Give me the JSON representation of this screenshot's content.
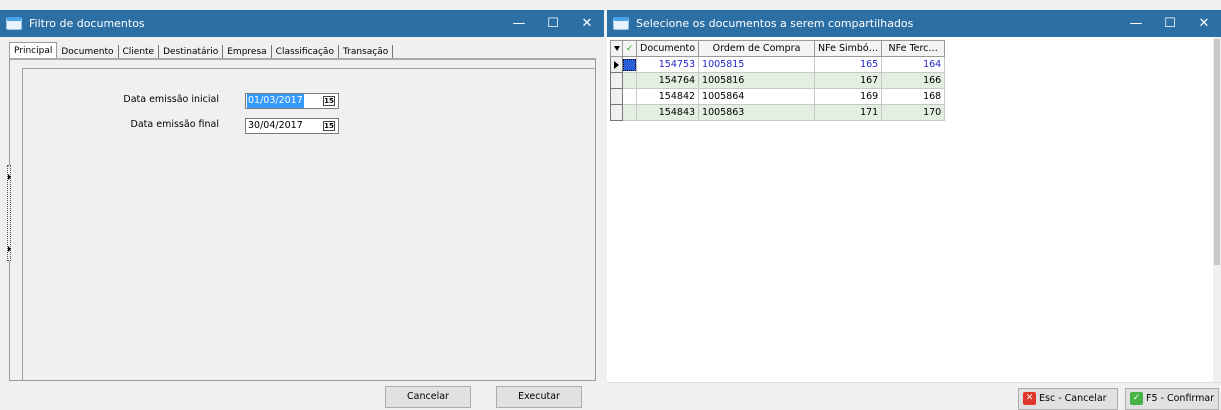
{
  "left_window": {
    "title": "Filtro de documentos",
    "controls": {
      "minimize": "—",
      "maximize": "☐",
      "close": "✕"
    },
    "tabs": [
      "Principal",
      "Documento",
      "Cliente",
      "Destinatário",
      "Empresa",
      "Classificação",
      "Transação"
    ],
    "active_tab": "Principal",
    "fields": {
      "start_label": "Data emissão inicial",
      "start_value": "01/03/2017",
      "end_label": "Data emissão final",
      "end_value": "30/04/2017"
    },
    "buttons": {
      "cancel": "Cancelar",
      "execute": "Executar"
    }
  },
  "right_window": {
    "title": "Selecione os documentos a serem compartilhados",
    "controls": {
      "minimize": "—",
      "maximize": "☐",
      "close": "✕"
    },
    "columns": {
      "check": "✓",
      "documento": "Documento",
      "ordem": "Ordem de Compra",
      "nfe_simb": "NFe Simbó…",
      "nfe_terc": "NFe Terc…"
    },
    "rows": [
      {
        "documento": "154753",
        "ordem": "1005815",
        "nfe_simb": "165",
        "nfe_terc": "164"
      },
      {
        "documento": "154764",
        "ordem": "1005816",
        "nfe_simb": "167",
        "nfe_terc": "166"
      },
      {
        "documento": "154842",
        "ordem": "1005864",
        "nfe_simb": "169",
        "nfe_terc": "168"
      },
      {
        "documento": "154843",
        "ordem": "1005863",
        "nfe_simb": "171",
        "nfe_terc": "170"
      }
    ],
    "buttons": {
      "cancel": "Esc - Cancelar",
      "confirm": "F5 - Confirmar"
    }
  },
  "colors": {
    "titlebar": "#2b6fa5",
    "row_alt": "#e3efe1",
    "selected_text": "#2424d0",
    "selection": "#3399ff"
  }
}
